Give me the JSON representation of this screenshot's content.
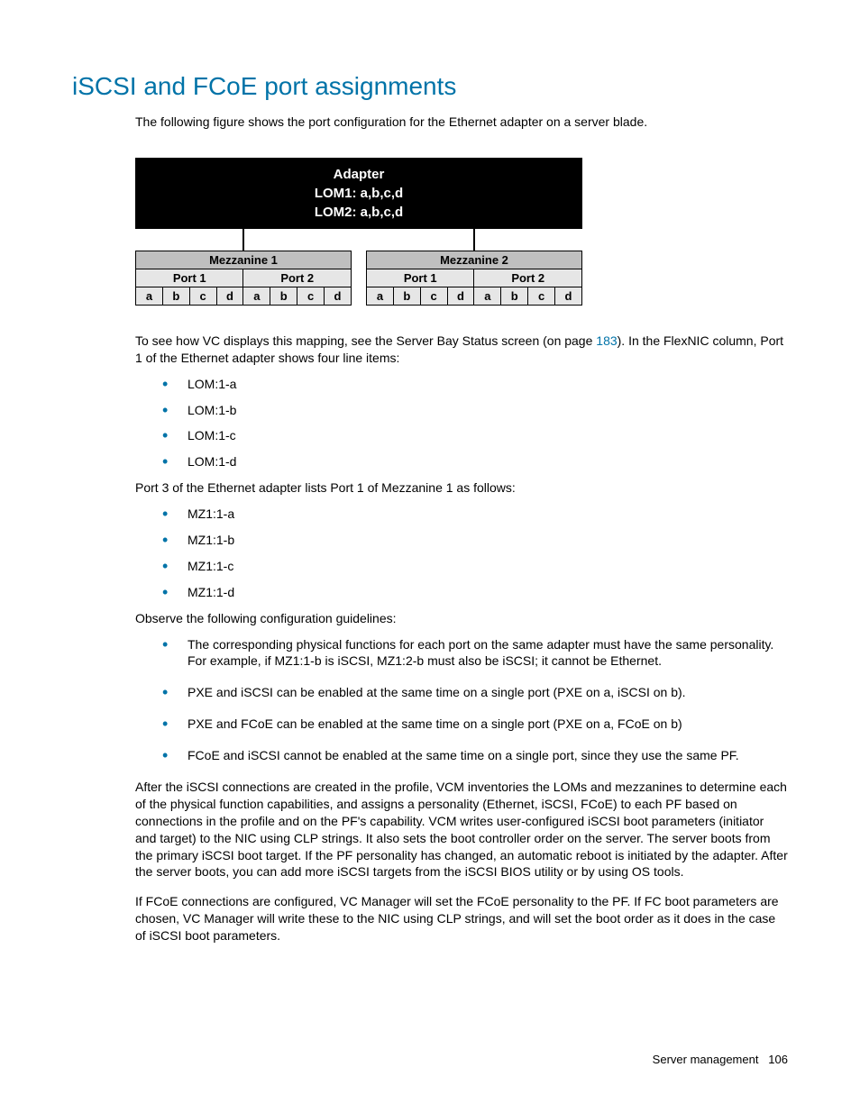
{
  "heading": "iSCSI and FCoE port assignments",
  "intro": "The following figure shows the port configuration for the Ethernet adapter on a server blade.",
  "diagram": {
    "adapter_line1": "Adapter",
    "adapter_line2": "LOM1: a,b,c,d",
    "adapter_line3": "LOM2: a,b,c,d",
    "mezzanines": [
      {
        "title": "Mezzanine 1",
        "ports": [
          {
            "label": "Port 1",
            "subports": [
              "a",
              "b",
              "c",
              "d"
            ]
          },
          {
            "label": "Port 2",
            "subports": [
              "a",
              "b",
              "c",
              "d"
            ]
          }
        ]
      },
      {
        "title": "Mezzanine 2",
        "ports": [
          {
            "label": "Port 1",
            "subports": [
              "a",
              "b",
              "c",
              "d"
            ]
          },
          {
            "label": "Port 2",
            "subports": [
              "a",
              "b",
              "c",
              "d"
            ]
          }
        ]
      }
    ]
  },
  "para_mapping_pre": "To see how VC displays this mapping, see the Server Bay Status screen (on page ",
  "para_mapping_link": "183",
  "para_mapping_post": "). In the FlexNIC column, Port 1 of the Ethernet adapter shows four line items:",
  "lom_list": [
    "LOM:1-a",
    "LOM:1-b",
    "LOM:1-c",
    "LOM:1-d"
  ],
  "para_port3": "Port 3 of the Ethernet adapter lists Port 1 of Mezzanine 1 as follows:",
  "mz_list": [
    "MZ1:1-a",
    "MZ1:1-b",
    "MZ1:1-c",
    "MZ1:1-d"
  ],
  "para_observe": "Observe the following configuration guidelines:",
  "guidelines": [
    "The corresponding physical functions for each port on the same adapter must have the same personality. For example, if MZ1:1-b is iSCSI, MZ1:2-b must also be iSCSI; it cannot be Ethernet.",
    "PXE and iSCSI can be enabled at the same time on a single port (PXE on a, iSCSI on b).",
    "PXE and FCoE can be enabled at the same time on a single port (PXE on a, FCoE on b)",
    "FCoE and iSCSI cannot be enabled at the same time on a single port, since they use the same PF."
  ],
  "para_after1": "After the iSCSI connections are created in the profile, VCM inventories the LOMs and mezzanines to determine each of the physical function capabilities, and assigns a personality (Ethernet, iSCSI, FCoE) to each PF based on connections in the profile and on the PF's capability. VCM writes user-configured iSCSI boot parameters (initiator and target) to the NIC using CLP strings. It also sets the boot controller order on the server. The server boots from the primary iSCSI boot target. If the PF personality has changed, an automatic reboot is initiated by the adapter. After the server boots, you can add more iSCSI targets from the iSCSI BIOS utility or by using OS tools.",
  "para_after2": "If FCoE connections are configured, VC Manager will set the FCoE personality to the PF. If FC boot parameters are chosen, VC Manager will write these to the NIC using CLP strings, and will set the boot order as it does in the case of iSCSI boot parameters.",
  "footer_section": "Server management",
  "footer_page": "106"
}
